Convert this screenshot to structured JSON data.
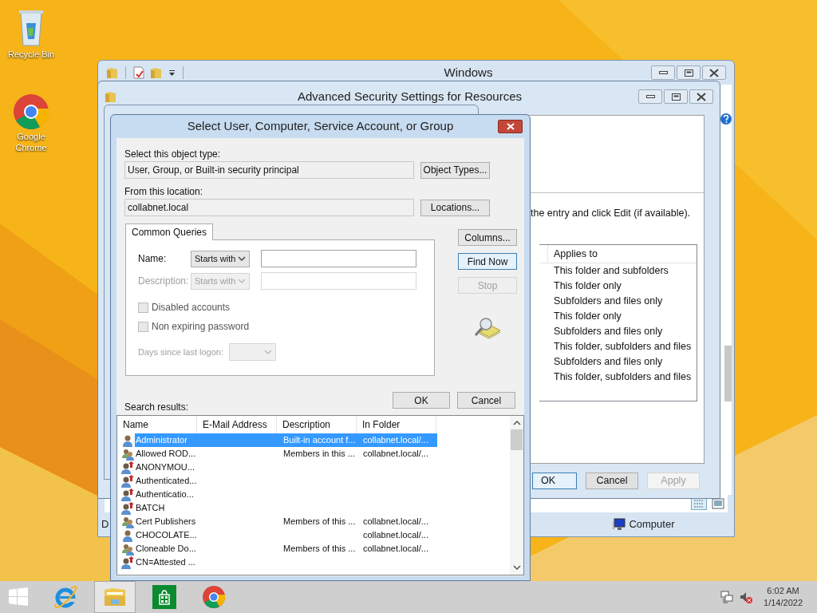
{
  "desktop_icons": [
    {
      "kind": "recycle",
      "label": "Recycle Bin"
    },
    {
      "kind": "chrome",
      "label": "Google Chrome"
    }
  ],
  "explorer_window": {
    "title": "Windows",
    "status_left": "D",
    "status_item": "Computer"
  },
  "advanced_window": {
    "title": "Advanced Security Settings for Resources",
    "instruction": "the entry and click Edit (if available).",
    "column": "Applies to",
    "rows": [
      "This folder and subfolders",
      "This folder only",
      "Subfolders and files only",
      "This folder only",
      "Subfolders and files only",
      "This folder, subfolders and files",
      "Subfolders and files only",
      "This folder, subfolders and files"
    ],
    "buttons": [
      {
        "label": "OK",
        "default": true,
        "disabled": false
      },
      {
        "label": "Cancel",
        "default": false,
        "disabled": false
      },
      {
        "label": "Apply",
        "default": false,
        "disabled": true
      }
    ]
  },
  "dialog": {
    "title": "Select User, Computer, Service Account, or Group",
    "object_type_label": "Select this object type:",
    "object_type": "User, Group, or Built-in security principal",
    "object_types_button": "Object Types...",
    "location_label": "From this location:",
    "location": "collabnet.local",
    "locations_button": "Locations...",
    "tabs": [
      {
        "label": "Common Queries",
        "selected": true
      }
    ],
    "query_fields": [
      {
        "label": "Name:",
        "match": "Starts with",
        "disabled": false
      },
      {
        "label": "Description:",
        "match": "Starts with",
        "disabled": true
      }
    ],
    "checkboxes": [
      {
        "label": "Disabled accounts",
        "checked": false
      },
      {
        "label": "Non expiring password",
        "checked": false
      }
    ],
    "days_label": "Days since last logon:",
    "side_buttons": [
      {
        "label": "Columns...",
        "default": false,
        "disabled": false
      },
      {
        "label": "Find Now",
        "default": true,
        "disabled": false
      },
      {
        "label": "Stop",
        "default": false,
        "disabled": true
      }
    ],
    "buttons": [
      {
        "label": "OK",
        "default": false,
        "disabled": false
      },
      {
        "label": "Cancel",
        "default": false,
        "disabled": false
      }
    ],
    "results_label": "Search results:",
    "columns": [
      "Name",
      "E-Mail Address",
      "Description",
      "In Folder"
    ],
    "results": [
      {
        "kind": "user",
        "name": "Administrator",
        "description": "Built-in account f...",
        "folder": "collabnet.local/...",
        "selected": true
      },
      {
        "kind": "group",
        "name": "Allowed ROD...",
        "description": "Members in this ...",
        "folder": "collabnet.local/...",
        "selected": false
      },
      {
        "kind": "principal",
        "name": "ANONYMOU...",
        "selected": false
      },
      {
        "kind": "principal",
        "name": "Authenticated...",
        "selected": false
      },
      {
        "kind": "principal",
        "name": "Authenticatio...",
        "selected": false
      },
      {
        "kind": "principal",
        "name": "BATCH",
        "selected": false
      },
      {
        "kind": "group",
        "name": "Cert Publishers",
        "description": "Members of this ...",
        "folder": "collabnet.local/...",
        "selected": false
      },
      {
        "kind": "user",
        "name": "CHOCOLATE...",
        "folder": "collabnet.local/...",
        "selected": false
      },
      {
        "kind": "group",
        "name": "Cloneable Do...",
        "description": "Members of this ...",
        "folder": "collabnet.local/...",
        "selected": false
      },
      {
        "kind": "principal",
        "name": "CN=Attested ...",
        "selected": false
      }
    ]
  },
  "taskbar": {
    "apps": [
      {
        "kind": "ie",
        "selected": false
      },
      {
        "kind": "explorer",
        "selected": true
      },
      {
        "kind": "store",
        "selected": false
      },
      {
        "kind": "chrome",
        "selected": false
      }
    ],
    "time": "6:02 AM",
    "date": "1/14/2022"
  }
}
